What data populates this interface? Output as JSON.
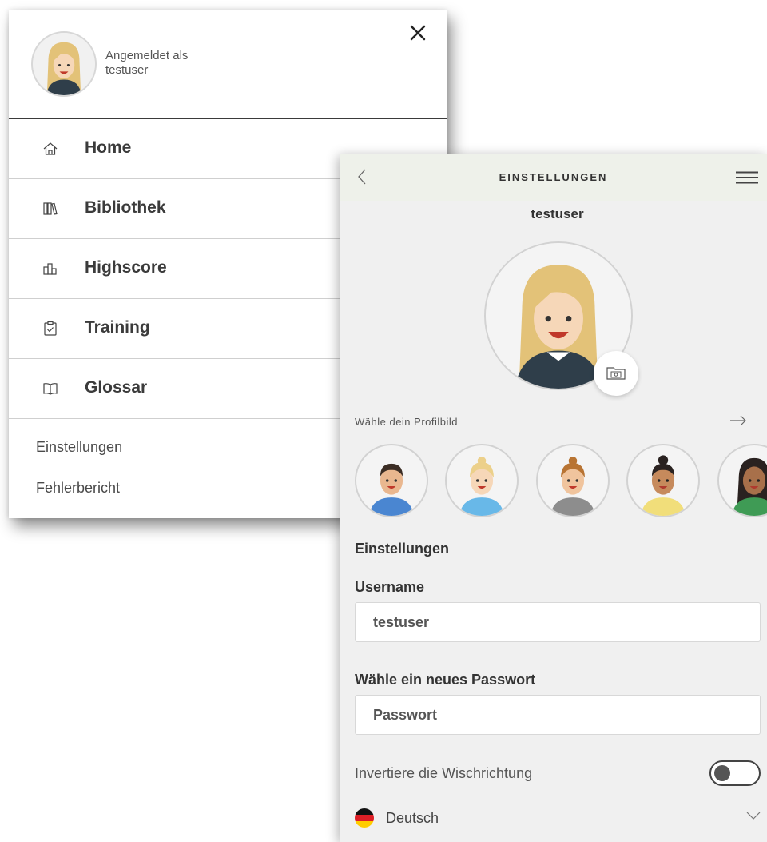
{
  "menu": {
    "logged_in_label": "Angemeldet als",
    "username": "testuser",
    "items": [
      {
        "label": "Home",
        "icon": "home-icon"
      },
      {
        "label": "Bibliothek",
        "icon": "library-icon"
      },
      {
        "label": "Highscore",
        "icon": "highscore-icon"
      },
      {
        "label": "Training",
        "icon": "training-clipboard-icon"
      },
      {
        "label": "Glossar",
        "icon": "book-open-icon"
      }
    ],
    "links": [
      {
        "label": "Einstellungen"
      },
      {
        "label": "Fehlerbericht"
      }
    ]
  },
  "settings": {
    "title": "EINSTELLUNGEN",
    "username": "testuser",
    "choose_avatar_label": "Wähle dein Profilbild",
    "section_title": "Einstellungen",
    "username_label": "Username",
    "username_value": "testuser",
    "password_label": "Wähle ein neues Passwort",
    "password_placeholder": "Passwort",
    "invert_swipe_label": "Invertiere die Wischrichtung",
    "invert_swipe_on": false,
    "language": "Deutsch"
  },
  "colors": {
    "topbar_bg": "#eef1ea",
    "panel_bg": "#f0f0f0",
    "menu_text": "#3b3b3b",
    "toggle_knob": "#555555"
  }
}
